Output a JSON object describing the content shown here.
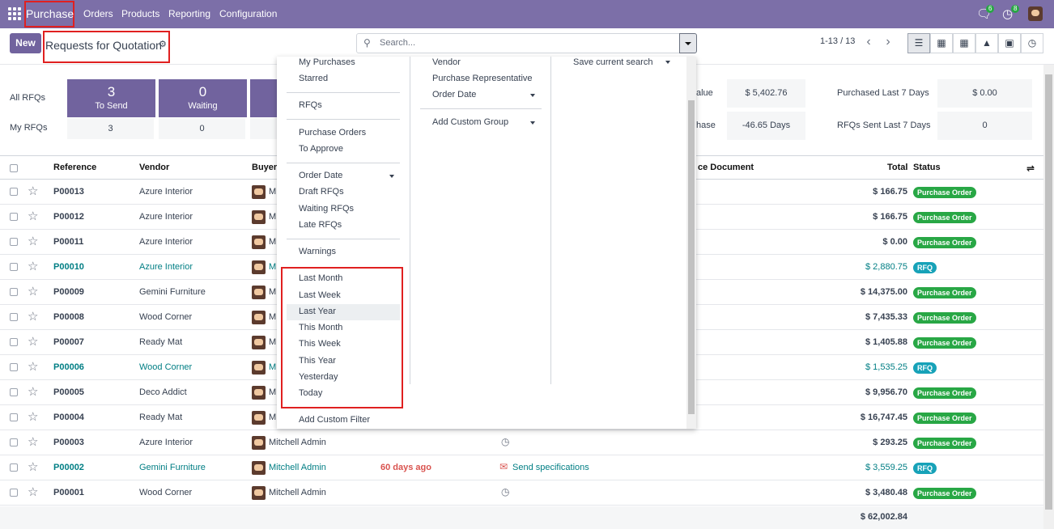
{
  "topbar": {
    "app_name": "Purchase",
    "menus": [
      "Orders",
      "Products",
      "Reporting",
      "Configuration"
    ],
    "chat_badge": "6",
    "activity_badge": "8"
  },
  "control": {
    "new_label": "New",
    "title": "Requests for Quotation",
    "search_placeholder": "Search...",
    "pager": "1-13 / 13"
  },
  "dashboard": {
    "all_rfqs_label": "All RFQs",
    "my_rfqs_label": "My RFQs",
    "tiles": [
      {
        "count": "3",
        "caption": "To Send",
        "mine": "3"
      },
      {
        "count": "0",
        "caption": "Waiting",
        "mine": "0"
      }
    ],
    "kpis": [
      {
        "label": "alue",
        "value": "$ 5,402.76"
      },
      {
        "label": "Purchased Last 7 Days",
        "value": "$ 0.00"
      },
      {
        "label": "hase",
        "value": "-46.65 Days"
      },
      {
        "label": "RFQs Sent Last 7 Days",
        "value": "0"
      }
    ]
  },
  "table": {
    "headers": {
      "reference": "Reference",
      "vendor": "Vendor",
      "buyer": "Buyer",
      "source": "ce Document",
      "total": "Total",
      "status": "Status"
    },
    "rows": [
      {
        "ref": "P00013",
        "vendor": "Azure Interior",
        "buyer": "M",
        "total": "$ 166.75",
        "status": "Purchase Order"
      },
      {
        "ref": "P00012",
        "vendor": "Azure Interior",
        "buyer": "M",
        "total": "$ 166.75",
        "status": "Purchase Order"
      },
      {
        "ref": "P00011",
        "vendor": "Azure Interior",
        "buyer": "M",
        "total": "$ 0.00",
        "status": "Purchase Order"
      },
      {
        "ref": "P00010",
        "vendor": "Azure Interior",
        "buyer": "M",
        "total": "$ 2,880.75",
        "status": "RFQ"
      },
      {
        "ref": "P00009",
        "vendor": "Gemini Furniture",
        "buyer": "M",
        "total": "$ 14,375.00",
        "status": "Purchase Order"
      },
      {
        "ref": "P00008",
        "vendor": "Wood Corner",
        "buyer": "M",
        "total": "$ 7,435.33",
        "status": "Purchase Order"
      },
      {
        "ref": "P00007",
        "vendor": "Ready Mat",
        "buyer": "M",
        "total": "$ 1,405.88",
        "status": "Purchase Order"
      },
      {
        "ref": "P00006",
        "vendor": "Wood Corner",
        "buyer": "M",
        "total": "$ 1,535.25",
        "status": "RFQ"
      },
      {
        "ref": "P00005",
        "vendor": "Deco Addict",
        "buyer": "M",
        "total": "$ 9,956.70",
        "status": "Purchase Order"
      },
      {
        "ref": "P00004",
        "vendor": "Ready Mat",
        "buyer": "M",
        "total": "$ 16,747.45",
        "status": "Purchase Order"
      },
      {
        "ref": "P00003",
        "vendor": "Azure Interior",
        "buyer": "Mitchell Admin",
        "total": "$ 293.25",
        "status": "Purchase Order"
      },
      {
        "ref": "P00002",
        "vendor": "Gemini Furniture",
        "buyer": "Mitchell Admin",
        "deadline": "60 days ago",
        "activity": "Send specifications",
        "total": "$ 3,559.25",
        "status": "RFQ"
      },
      {
        "ref": "P00001",
        "vendor": "Wood Corner",
        "buyer": "Mitchell Admin",
        "total": "$ 3,480.48",
        "status": "Purchase Order"
      }
    ],
    "grand_total": "$ 62,002.84"
  },
  "dropdown": {
    "filters": {
      "my_purchases": "My Purchases",
      "starred": "Starred",
      "rfqs": "RFQs",
      "purchase_orders": "Purchase Orders",
      "to_approve": "To Approve",
      "order_date": "Order Date",
      "draft_rfqs": "Draft RFQs",
      "waiting_rfqs": "Waiting RFQs",
      "late_rfqs": "Late RFQs",
      "warnings": "Warnings",
      "date_options": [
        "Last Month",
        "Last Week",
        "Last Year",
        "This Month",
        "This Week",
        "This Year",
        "Yesterday",
        "Today"
      ],
      "add_custom": "Add Custom Filter"
    },
    "group_by": {
      "vendor": "Vendor",
      "rep": "Purchase Representative",
      "order_date": "Order Date",
      "add_custom": "Add Custom Group"
    },
    "favorites": {
      "save_search": "Save current search"
    }
  },
  "colors": {
    "brand": "#7c6fa8",
    "button": "#71639e",
    "po_tag": "#28a745",
    "rfq_tag": "#17a2b8",
    "highlight": "#e02020"
  }
}
